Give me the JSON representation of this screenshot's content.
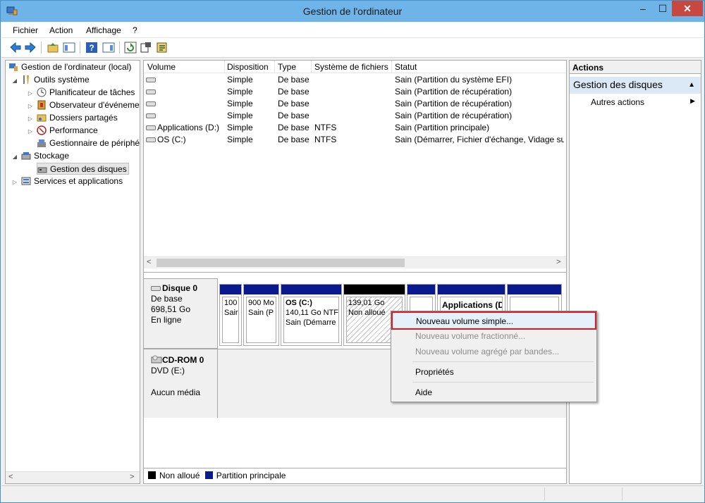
{
  "window": {
    "title": "Gestion de l'ordinateur"
  },
  "title_buttons": {
    "minimize": "–",
    "maximize": "☐",
    "close": "✕"
  },
  "menu": [
    "Fichier",
    "Action",
    "Affichage",
    "?"
  ],
  "tree": {
    "items": [
      {
        "label": "Gestion de l'ordinateur (local)",
        "level": 0,
        "expander": ""
      },
      {
        "label": "Outils système",
        "level": 1,
        "expander": "◢"
      },
      {
        "label": "Planificateur de tâches",
        "level": 2,
        "expander": "▷"
      },
      {
        "label": "Observateur d'événeme",
        "level": 2,
        "expander": "▷"
      },
      {
        "label": "Dossiers partagés",
        "level": 2,
        "expander": "▷"
      },
      {
        "label": "Performance",
        "level": 2,
        "expander": "▷"
      },
      {
        "label": "Gestionnaire de périphé",
        "level": 2,
        "expander": ""
      },
      {
        "label": "Stockage",
        "level": 1,
        "expander": "◢"
      },
      {
        "label": "Gestion des disques",
        "level": 2,
        "expander": ""
      },
      {
        "label": "Services et applications",
        "level": 1,
        "expander": "▷"
      }
    ]
  },
  "volumes": {
    "headers": [
      "Volume",
      "Disposition",
      "Type",
      "Système de fichiers",
      "Statut"
    ],
    "rows": [
      [
        "",
        "Simple",
        "De base",
        "",
        "Sain (Partition du système EFI)"
      ],
      [
        "",
        "Simple",
        "De base",
        "",
        "Sain (Partition de récupération)"
      ],
      [
        "",
        "Simple",
        "De base",
        "",
        "Sain (Partition de récupération)"
      ],
      [
        "",
        "Simple",
        "De base",
        "",
        "Sain (Partition de récupération)"
      ],
      [
        "Applications (D:)",
        "Simple",
        "De base",
        "NTFS",
        "Sain (Partition principale)"
      ],
      [
        "OS (C:)",
        "Simple",
        "De base",
        "NTFS",
        "Sain (Démarrer, Fichier d'échange, Vidage sur"
      ]
    ]
  },
  "scroll": {
    "left": "<",
    "right": ">"
  },
  "disk0": {
    "name": "Disque 0",
    "type": "De base",
    "size": "698,51 Go",
    "state": "En ligne",
    "parts": [
      {
        "title": "",
        "line1": "100",
        "line2": "Sair"
      },
      {
        "title": "",
        "line1": "900 Mo",
        "line2": "Sain (P"
      },
      {
        "title": "OS  (C:)",
        "line1": "140,11 Go NTF",
        "line2": "Sain (Démarre"
      },
      {
        "title": "",
        "line1": "139,01 Go",
        "line2": "Non alloué"
      },
      {
        "title": "",
        "line1": "",
        "line2": ""
      },
      {
        "title": "Applications  (D",
        "line1": "",
        "line2": ""
      },
      {
        "title": "",
        "line1": "",
        "line2": ""
      }
    ]
  },
  "cdrom": {
    "name": "CD-ROM 0",
    "type": "DVD (E:)",
    "state": "Aucun média"
  },
  "legend": {
    "unallocated": "Non alloué",
    "primary": "Partition principale"
  },
  "actions": {
    "title": "Actions",
    "group": "Gestion des disques",
    "item": "Autres actions"
  },
  "context_menu": {
    "items": [
      {
        "label": "Nouveau volume simple...",
        "enabled": true
      },
      {
        "label": "Nouveau volume fractionné...",
        "enabled": false
      },
      {
        "label": "Nouveau volume agrégé par bandes...",
        "enabled": false
      },
      {
        "label": "Propriétés",
        "enabled": true
      },
      {
        "label": "Aide",
        "enabled": true
      }
    ]
  },
  "colors": {
    "titlebar": "#6fb4e8",
    "close": "#c8483f",
    "primary_partition": "#0a1a8c",
    "unallocated": "#000000",
    "highlight_border": "#d02020"
  }
}
